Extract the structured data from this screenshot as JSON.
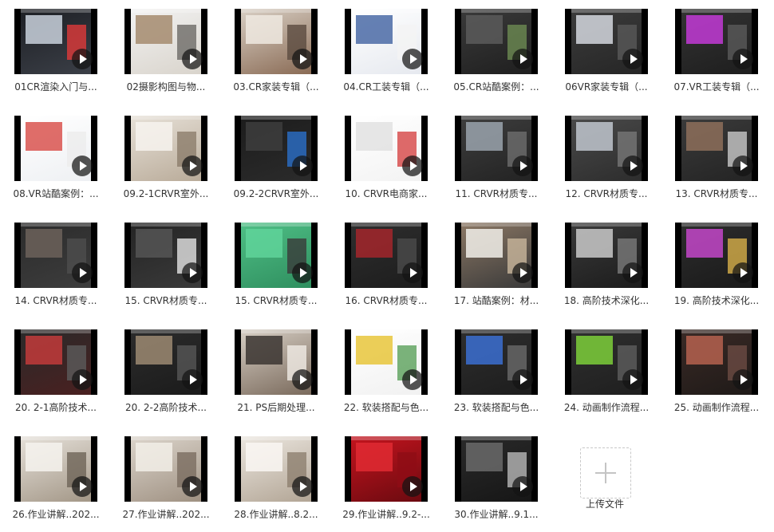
{
  "videos": [
    {
      "title": "01CR渲染入门与...",
      "c1": "#1d1f24",
      "c2": "#3b3f47",
      "c3": "#c9d1dc",
      "c4": "#e03a3a"
    },
    {
      "title": "02摄影构图与物...",
      "c1": "#f2f2f2",
      "c2": "#d9d4cc",
      "c3": "#a58b6f",
      "c4": "#6d6a67"
    },
    {
      "title": "03.CR家装专辑（...",
      "c1": "#d8cfc4",
      "c2": "#8a6b55",
      "c3": "#efe9e1",
      "c4": "#5b4b40"
    },
    {
      "title": "04.CR工装专辑（...",
      "c1": "#ffffff",
      "c2": "#e6e9ef",
      "c3": "#4a6aa6",
      "c4": "#f4f4f4"
    },
    {
      "title": "05.CR站酷案例：...",
      "c1": "#3a3a3a",
      "c2": "#1f1f1f",
      "c3": "#5a5a5a",
      "c4": "#6d8b52"
    },
    {
      "title": "06VR家装专辑（...",
      "c1": "#3c3c3c",
      "c2": "#262626",
      "c3": "#d4d7de",
      "c4": "#595959"
    },
    {
      "title": "07.VR工装专辑（...",
      "c1": "#333333",
      "c2": "#1e1e1e",
      "c3": "#c23ad6",
      "c4": "#5a5a5a"
    },
    {
      "title": "08.VR站酷案例：...",
      "c1": "#ffffff",
      "c2": "#eef0f3",
      "c3": "#d9534f",
      "c4": "#ececec"
    },
    {
      "title": "09.2-1CRVR室外...",
      "c1": "#e7e1d8",
      "c2": "#b9ab99",
      "c3": "#f7f3ee",
      "c4": "#8c7d6b"
    },
    {
      "title": "09.2-2CRVR室外...",
      "c1": "#1c1c1c",
      "c2": "#2b2b2b",
      "c3": "#3d3d3d",
      "c4": "#2a6fc9"
    },
    {
      "title": "10. CRVR电商家...",
      "c1": "#ffffff",
      "c2": "#f3f3f3",
      "c3": "#e2e2e2",
      "c4": "#d64545"
    },
    {
      "title": "11. CRVR材质专...",
      "c1": "#3e3e3e",
      "c2": "#232323",
      "c3": "#9aa3ad",
      "c4": "#6e6e6e"
    },
    {
      "title": "12. CRVR材质专...",
      "c1": "#4a4a4a",
      "c2": "#2d2d2d",
      "c3": "#bfc6ce",
      "c4": "#777777"
    },
    {
      "title": "13. CRVR材质专...",
      "c1": "#3b3b3b",
      "c2": "#242424",
      "c3": "#8d6f5a",
      "c4": "#c9c9c9"
    },
    {
      "title": "14. CRVR材质专...",
      "c1": "#2b2b2b",
      "c2": "#3d3d3d",
      "c3": "#6c625a",
      "c4": "#4d4d4d"
    },
    {
      "title": "15. CRVR材质专...",
      "c1": "#242424",
      "c2": "#3a3a3a",
      "c3": "#555555",
      "c4": "#e4e4e4"
    },
    {
      "title": "15. CRVR材质专...",
      "c1": "#4fbf86",
      "c2": "#2f8f5f",
      "c3": "#5fd39a",
      "c4": "#3a3a3a"
    },
    {
      "title": "16. CRVR材质专...",
      "c1": "#2e2e2e",
      "c2": "#1d1d1d",
      "c3": "#a3262c",
      "c4": "#4b4b4b"
    },
    {
      "title": "17. 站酷案例：材...",
      "c1": "#8b7764",
      "c2": "#3a3a3a",
      "c3": "#f1eee9",
      "c4": "#c9b79c"
    },
    {
      "title": "18. 高阶技术深化...",
      "c1": "#3a3a3a",
      "c2": "#1c1c1c",
      "c3": "#c9c9c9",
      "c4": "#7a7a7a"
    },
    {
      "title": "19. 高阶技术深化...",
      "c1": "#2d2d2d",
      "c2": "#1a1a1a",
      "c3": "#c347c9",
      "c4": "#d8b04a"
    },
    {
      "title": "20. 2-1高阶技术...",
      "c1": "#2a2a2a",
      "c2": "#4a2020",
      "c3": "#c23b3b",
      "c4": "#5b5b5b"
    },
    {
      "title": "20. 2-2高阶技术...",
      "c1": "#2c2c2c",
      "c2": "#1b1b1b",
      "c3": "#9c8a72",
      "c4": "#565656"
    },
    {
      "title": "21. PS后期处理...",
      "c1": "#d6cec4",
      "c2": "#7a6a5c",
      "c3": "#3b3531",
      "c4": "#f0ebe5"
    },
    {
      "title": "22. 软装搭配与色...",
      "c1": "#ffffff",
      "c2": "#f1f1f1",
      "c3": "#e8c63b",
      "c4": "#5aa05a"
    },
    {
      "title": "23. 软装搭配与色...",
      "c1": "#2e2e2e",
      "c2": "#1d1d1d",
      "c3": "#3b6fd1",
      "c4": "#6a6a6a"
    },
    {
      "title": "24. 动画制作流程...",
      "c1": "#2f2f2f",
      "c2": "#1f1f1f",
      "c3": "#7dcf3a",
      "c4": "#5e5e5e"
    },
    {
      "title": "25. 动画制作流程...",
      "c1": "#3a2a26",
      "c2": "#1f1a18",
      "c3": "#b5614f",
      "c4": "#6b4b44"
    },
    {
      "title": "26.作业讲解..202...",
      "c1": "#e6e1da",
      "c2": "#a39787",
      "c3": "#f6f3ef",
      "c4": "#6e6457"
    },
    {
      "title": "27.作业讲解..202...",
      "c1": "#dcd5cc",
      "c2": "#9f9182",
      "c3": "#f2eee8",
      "c4": "#7b6d60"
    },
    {
      "title": "28.作业讲解..8.2...",
      "c1": "#ece7e0",
      "c2": "#b2a595",
      "c3": "#faf7f3",
      "c4": "#8d7f6f"
    },
    {
      "title": "29.作业讲解..9.2-...",
      "c1": "#c4141e",
      "c2": "#6b0a10",
      "c3": "#e02a32",
      "c4": "#8e0d15"
    },
    {
      "title": "30.作业讲解..9.1...",
      "c1": "#2a2a2a",
      "c2": "#161616",
      "c3": "#6a6a6a",
      "c4": "#b8b8b8"
    }
  ],
  "upload": {
    "label": "上传文件",
    "icon": "plus-icon"
  },
  "icons": {
    "play": "play-icon"
  }
}
